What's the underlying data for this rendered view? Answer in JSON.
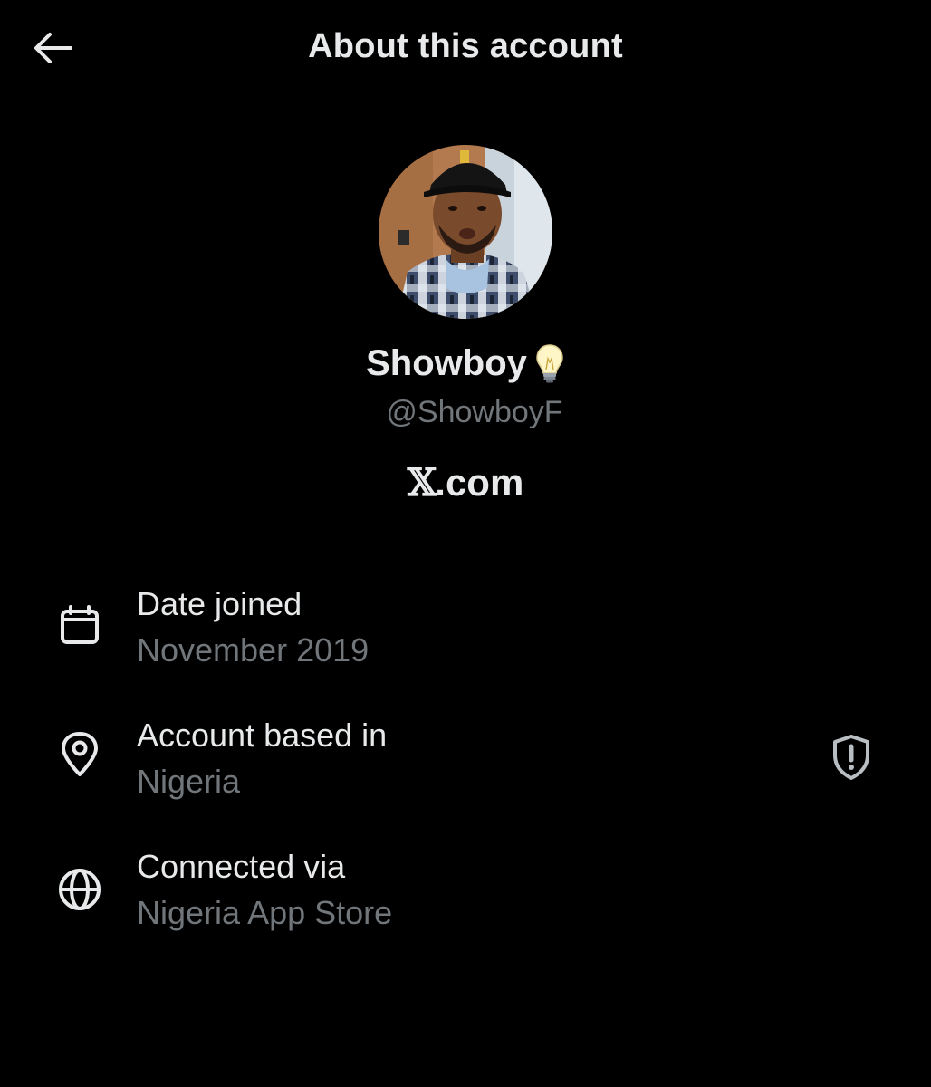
{
  "header": {
    "title": "About this account",
    "back_icon": "arrow-left-icon"
  },
  "profile": {
    "display_name": "Showboy",
    "name_emoji": "light-bulb-icon",
    "handle": "@ShowboyF",
    "platform_logo": "𝕏",
    "platform_suffix": ".com"
  },
  "details": [
    {
      "icon": "calendar-icon",
      "label": "Date joined",
      "value": "November 2019"
    },
    {
      "icon": "location-pin-icon",
      "label": "Account based in",
      "value": "Nigeria",
      "trailing_icon": "shield-alert-icon"
    },
    {
      "icon": "globe-icon",
      "label": "Connected via",
      "value": "Nigeria App Store"
    }
  ],
  "colors": {
    "background": "#000000",
    "primary_text": "#e7e9ea",
    "secondary_text": "#71767b"
  }
}
